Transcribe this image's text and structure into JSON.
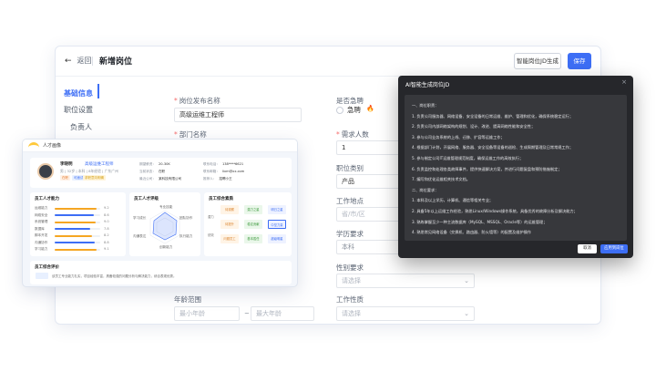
{
  "header": {
    "back": "返回",
    "title": "新增岗位",
    "ai_button": "智能岗位JD生成",
    "save": "保存"
  },
  "nav": [
    "基础信息",
    "职位设置",
    "负责人"
  ],
  "form": {
    "job_name_label": "岗位发布名称",
    "job_name_value": "高级运维工程师",
    "urgent_label": "是否急聘",
    "urgent_option": "急聘",
    "dept_label": "部门名称",
    "headcount_label": "需求人数",
    "headcount_value": "1",
    "category_label": "职位类别",
    "category_value": "产品",
    "location_label": "工作地点",
    "location_value": "省/市/区",
    "edu_label": "学历要求",
    "edu_value": "本科",
    "gender_label": "性别要求",
    "gender_value": "请选择",
    "age_label": "年龄范围",
    "age_min": "最小年龄",
    "age_max": "最大年龄",
    "nature_label": "工作性质",
    "nature_value": "请选择"
  },
  "dashboard": {
    "title": "人才画像",
    "name": "李晓明",
    "role": "高级运维工程师",
    "meta": "男 | 32岁 | 本科 | 8年经验 | 广东广州",
    "tags": [
      "在职",
      "可面试",
      "求职意向明确"
    ],
    "kv": [
      {
        "k": "期望薪资：",
        "v": "20-30K"
      },
      {
        "k": "当前状态：",
        "v": "在职"
      },
      {
        "k": "最近公司：",
        "v": "某科技有限公司"
      },
      {
        "k": "联系电话：",
        "v": "138****6621"
      },
      {
        "k": "联系邮箱：",
        "v": "lixm@xx.com"
      },
      {
        "k": "推荐人：",
        "v": "招聘小王"
      }
    ],
    "card1_title": "员工人才能力",
    "skills": [
      {
        "name": "运维能力",
        "value": "9.2",
        "pct": 0.92,
        "color": "#f5a623"
      },
      {
        "name": "网络安全",
        "value": "8.6",
        "pct": 0.86,
        "color": "#3d6ef5"
      },
      {
        "name": "系统管理",
        "value": "9.0",
        "pct": 0.9,
        "color": "#f5a623"
      },
      {
        "name": "数据库",
        "value": "7.8",
        "pct": 0.78,
        "color": "#3d6ef5"
      },
      {
        "name": "脚本开发",
        "value": "8.2",
        "pct": 0.82,
        "color": "#f5a623"
      },
      {
        "name": "沟通协作",
        "value": "8.8",
        "pct": 0.88,
        "color": "#3d6ef5"
      },
      {
        "name": "学习能力",
        "value": "9.1",
        "pct": 0.91,
        "color": "#f5a623"
      }
    ],
    "card2_title": "员工人才评级",
    "radar_labels": [
      "专业技能",
      "团队协作",
      "执行能力",
      "创新能力",
      "沟通表达",
      "学习成长"
    ],
    "card3_title": "员工综合素质",
    "quad_side": [
      "潜力",
      "绩效"
    ],
    "quad_boxes": [
      "待观察",
      "潜力之星",
      "明日之星",
      "待提升",
      "稳定贡献",
      "中坚力量",
      "问题员工",
      "基本胜任",
      "超级明星"
    ],
    "eval_title": "员工综合评价",
    "eval_text": "该员工专业能力扎实，项目经验丰富，具备较强的问题分析与解决能力，综合表现优秀。"
  },
  "dialog": {
    "title": "AI智能生成岗位JD",
    "lines": [
      "一、岗位职责：",
      "1. 负责公司服务器、网络设备、安全设备的日常运维、维护、管理和优化，确保系统稳定运行；",
      "2. 负责公司内部网络架构的规划、设计、改进、提高网络性能和安全性；",
      "3. 参与公司业务系统的上线、迁移、扩容等运维工作；",
      "4. 根据部门计划，开展网络、服务器、安全设备等设备的巡检、生成周期管理及日常常规工作；",
      "5. 参与制定公司IT运维管理规范制度，确保运维工作的高效执行；",
      "6. 负责监控和处理各类故障事件，提供快速解决方案，并进行问题复盘和预防措施制定；",
      "7. 编写和优化运维相关技术文档。",
      "二、岗位要求：",
      "1. 本科及以上学历，计算机、通信等相关专业；",
      "2. 具备5年以上运维工作经验，熟悉Linux/Windows操作系统，具备优秀的故障分析及解决能力；",
      "3. 熟练掌握至少一种主流数据库（MySQL、MSSQL、Oracle等）的运维管理；",
      "4. 熟悉常见网络设备（交换机、路由器、防火墙等）的配置及维护操作"
    ],
    "cancel": "取消",
    "apply": "应用到岗位"
  }
}
